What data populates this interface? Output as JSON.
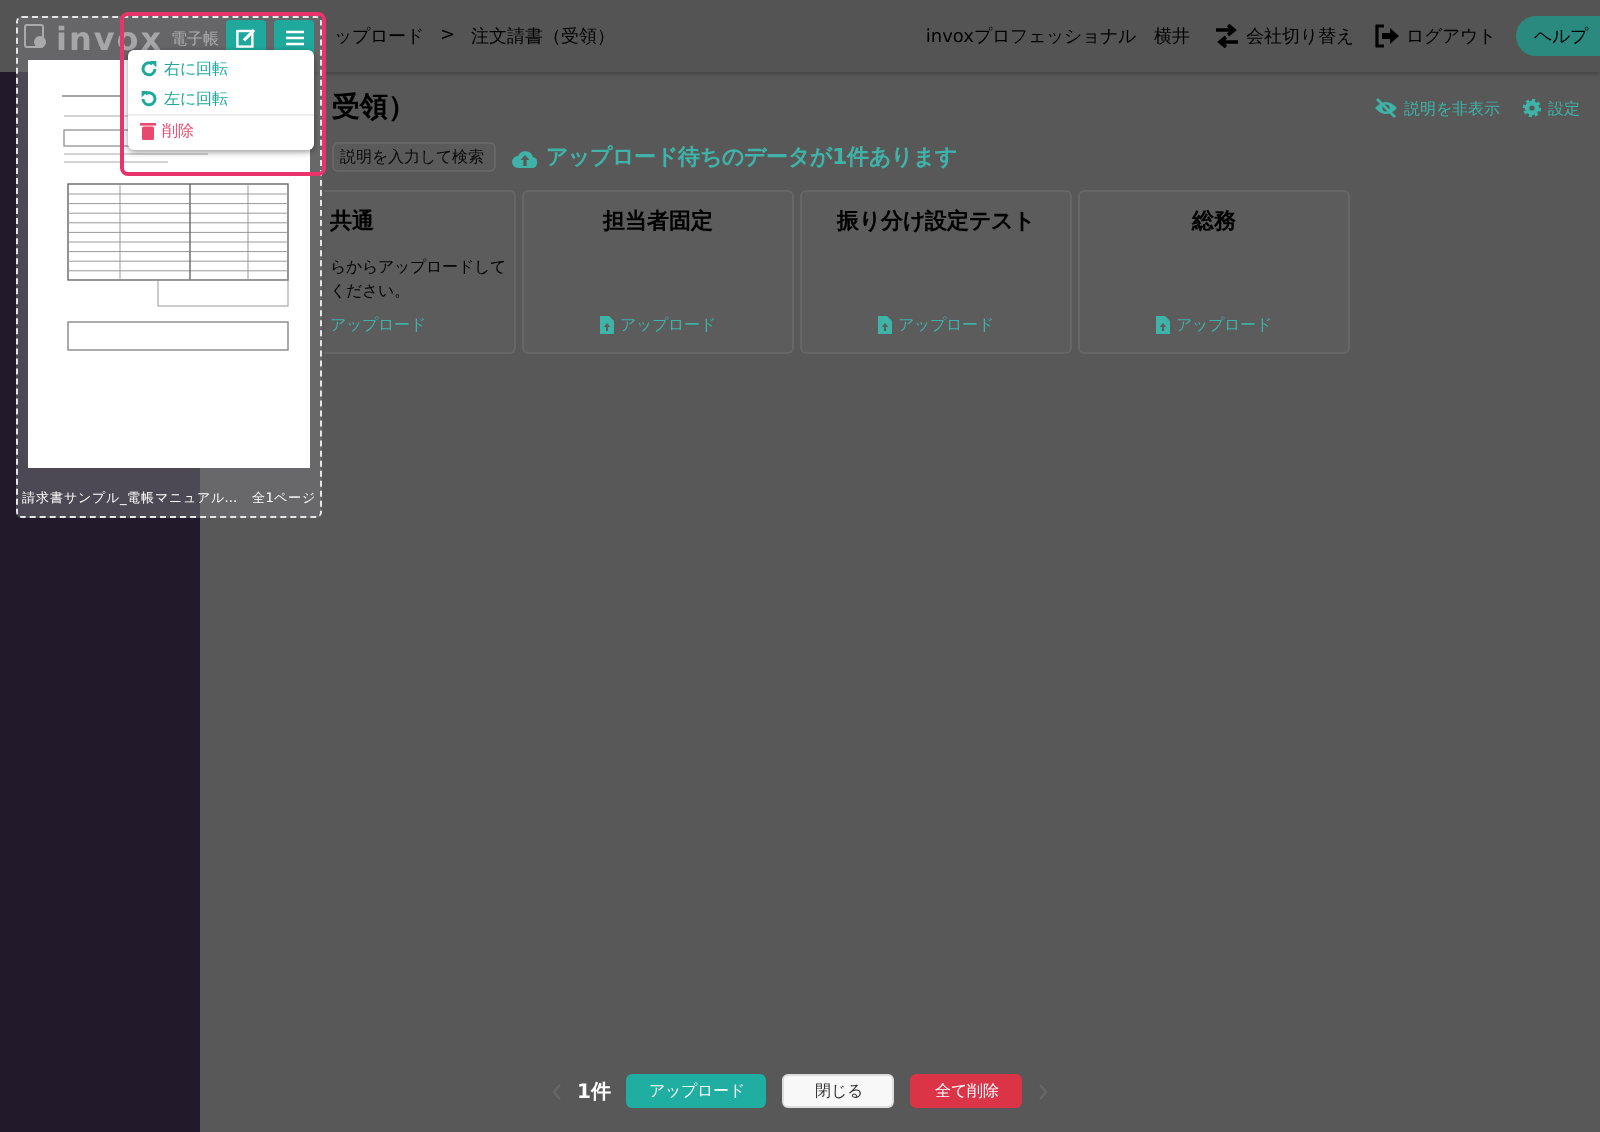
{
  "header": {
    "logo": [
      "invox",
      "電子帳"
    ],
    "breadcrumb": [
      "ップロード",
      "注文請書（受領）"
    ],
    "breadcrumb_separator": ">",
    "user": "invoxプロフェッショナル　横井",
    "links": [
      {
        "kind": "switch",
        "label": "会社切り替え"
      },
      {
        "kind": "logout",
        "label": "ログアウト"
      }
    ],
    "help_button": "ヘルプ"
  },
  "page": {
    "title": "受領）",
    "links": [
      {
        "kind": "hide",
        "label": "説明を非表示"
      },
      {
        "kind": "settings",
        "label": "設定"
      }
    ],
    "search": {
      "placeholder": "説明を入力して検索"
    },
    "notice": "アップロード待ちのデータが1件あります"
  },
  "cards": [
    {
      "title": "共通",
      "description_lines": [
        "らからアップロードして",
        "ください。"
      ],
      "upload": "アップロード",
      "show_icon": false
    },
    {
      "title": "担当者固定",
      "upload": "アップロード",
      "show_icon": true
    },
    {
      "title": "振り分け設定テスト",
      "upload": "アップロード",
      "show_icon": true
    },
    {
      "title": "総務",
      "upload": "アップロード",
      "show_icon": true
    }
  ],
  "document": {
    "caption": "請求書サンプル_電帳マニュアル...",
    "pages": "全1ページ",
    "menu": [
      {
        "kind": "rotate-right",
        "label": "右に回転"
      },
      {
        "kind": "rotate-left",
        "label": "左に回転"
      },
      {
        "kind": "delete",
        "label": "削除"
      }
    ]
  },
  "footer": {
    "count": "1件",
    "buttons": [
      {
        "kind": "primary",
        "label": "アップロード"
      },
      {
        "kind": "default",
        "label": "閉じる"
      },
      {
        "kind": "danger",
        "label": "全て削除"
      }
    ]
  }
}
